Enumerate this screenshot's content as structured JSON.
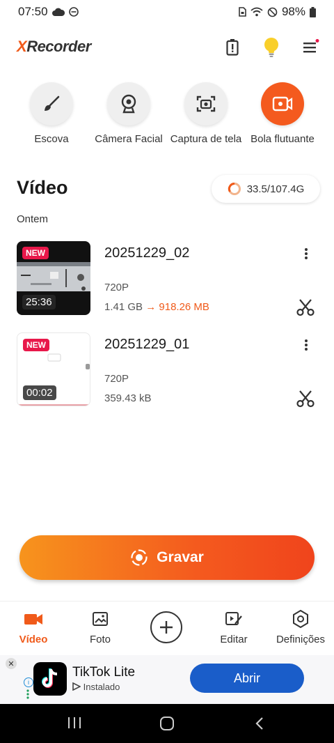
{
  "status_bar": {
    "time": "07:50",
    "battery": "98%",
    "icons": [
      "cloud-icon",
      "dnd-icon",
      "sim-icon",
      "wifi-icon",
      "blocked-icon",
      "battery-icon"
    ]
  },
  "app_bar": {
    "logo_x": "X",
    "logo_rest": "Recorder",
    "icons": [
      "battery-alert-icon",
      "lightbulb-icon",
      "menu-icon"
    ]
  },
  "tools": [
    {
      "label": "Escova",
      "icon": "brush-icon"
    },
    {
      "label": "Câmera Facial",
      "icon": "webcam-icon"
    },
    {
      "label": "Captura de tela",
      "icon": "screenshot-icon"
    },
    {
      "label": "Bola flutuante",
      "icon": "floating-ball-icon"
    }
  ],
  "section": {
    "title": "Vídeo",
    "storage": "33.5/107.4G",
    "group_label": "Ontem"
  },
  "videos": [
    {
      "name": "20251229_02",
      "badge": "NEW",
      "duration": "25:36",
      "resolution": "720P",
      "size": "1.41 GB",
      "arrow": "→",
      "compressed": "918.26 MB"
    },
    {
      "name": "20251229_01",
      "badge": "NEW",
      "duration": "00:02",
      "resolution": "720P",
      "size": "359.43 kB",
      "arrow": "",
      "compressed": ""
    }
  ],
  "record_button": {
    "label": "Gravar"
  },
  "bottom_nav": [
    {
      "label": "Vídeo",
      "icon": "video-camera-icon",
      "active": true
    },
    {
      "label": "Foto",
      "icon": "photo-icon",
      "active": false
    },
    {
      "label": "Editar",
      "icon": "edit-video-icon",
      "active": false
    },
    {
      "label": "Definições",
      "icon": "settings-icon",
      "active": false
    }
  ],
  "ad": {
    "close": "✕",
    "info": "i",
    "title": "TikTok Lite",
    "subtitle": "Instalado",
    "button": "Abrir"
  },
  "colors": {
    "accent": "#f45a1e",
    "new_badge": "#e8184a",
    "ad_button": "#1a5dc9"
  }
}
